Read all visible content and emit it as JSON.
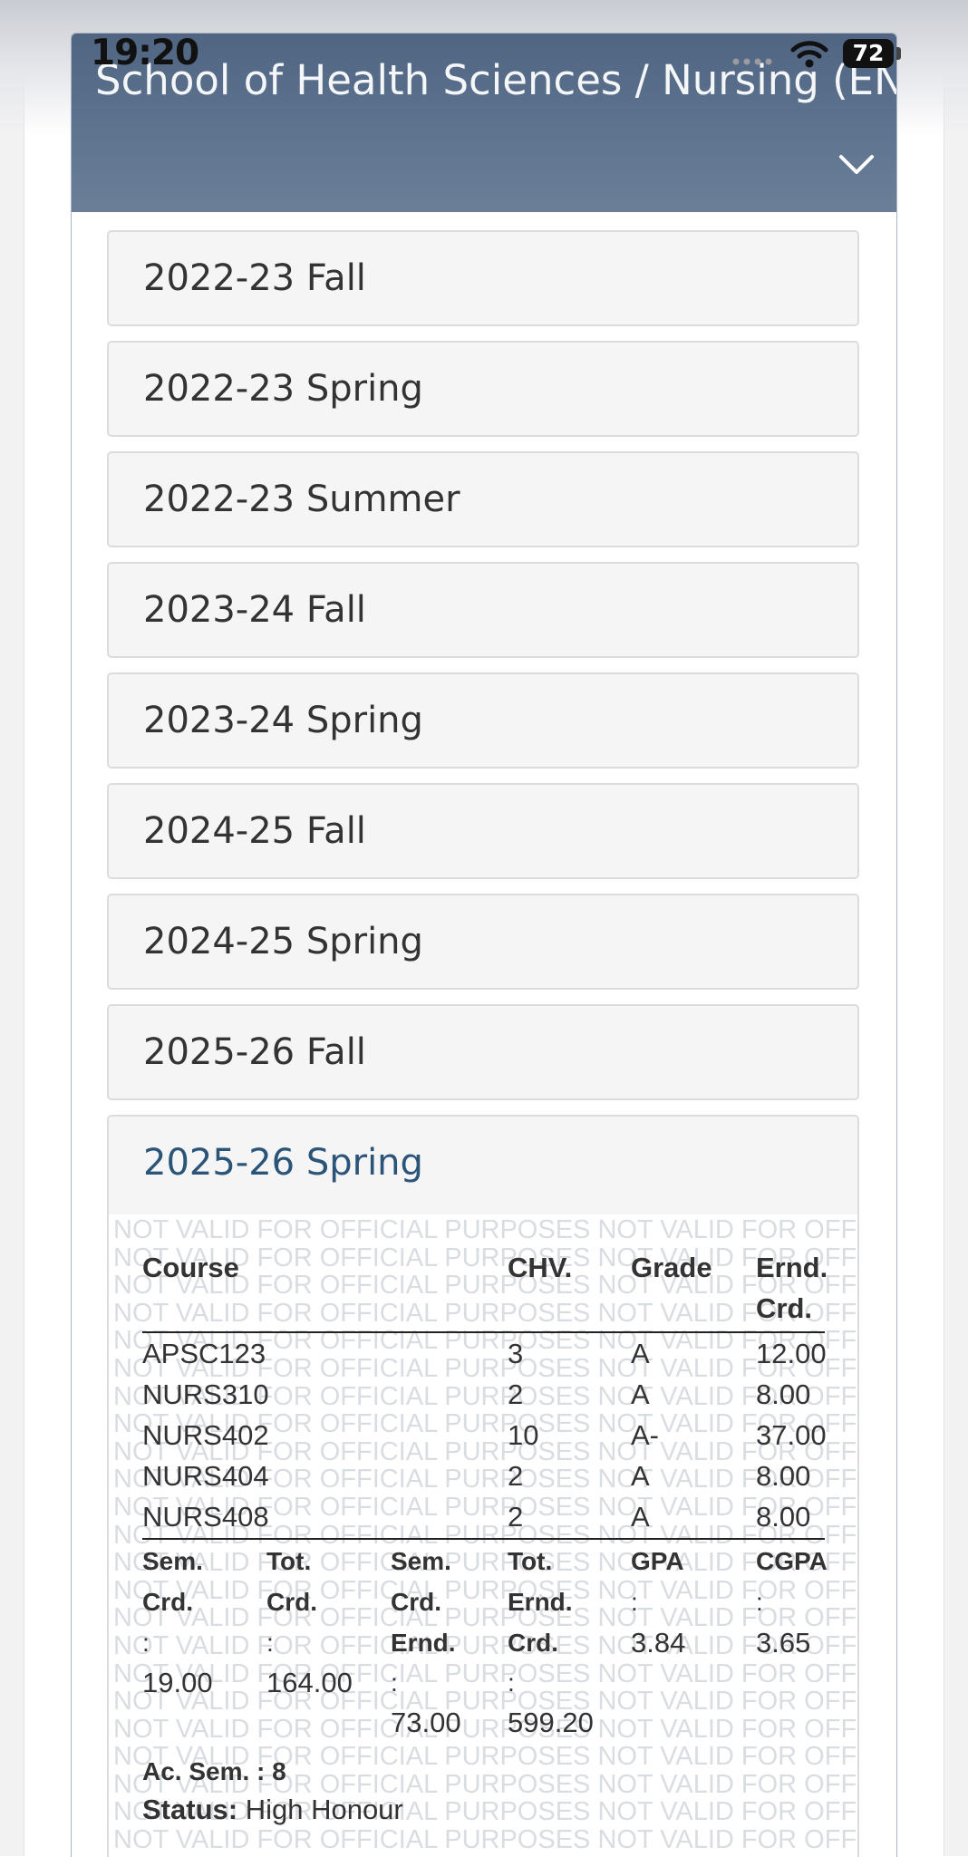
{
  "status_bar": {
    "time": "19:20",
    "battery": "72"
  },
  "header": {
    "title": "School of Health Sciences / Nursing (EN)"
  },
  "terms": [
    {
      "label": "2022-23 Fall"
    },
    {
      "label": "2022-23 Spring"
    },
    {
      "label": "2022-23 Summer"
    },
    {
      "label": "2023-24 Fall"
    },
    {
      "label": "2023-24 Spring"
    },
    {
      "label": "2024-25 Fall"
    },
    {
      "label": "2024-25 Spring"
    },
    {
      "label": "2025-26 Fall"
    },
    {
      "label": "2025-26 Spring"
    }
  ],
  "watermark": "NOT VALID FOR OFFICIAL PURPOSES NOT VALID FOR OFFICIAL PURPOSES",
  "table": {
    "headers": {
      "course": "Course",
      "chv": "CHV.",
      "grade": "Grade",
      "ernd": "Ernd.",
      "crd": "Crd."
    },
    "rows": [
      {
        "course": "APSC123",
        "chv": "3",
        "grade": "A",
        "earned": "12.00"
      },
      {
        "course": "NURS310",
        "chv": "2",
        "grade": "A",
        "earned": "8.00"
      },
      {
        "course": "NURS402",
        "chv": "10",
        "grade": "A-",
        "earned": "37.00"
      },
      {
        "course": "NURS404",
        "chv": "2",
        "grade": "A",
        "earned": "8.00"
      },
      {
        "course": "NURS408",
        "chv": "2",
        "grade": "A",
        "earned": "8.00"
      }
    ]
  },
  "summary": {
    "sem_crd_l1": "Sem.",
    "sem_crd_l2": "Crd.",
    "sem_crd_value": "19.00",
    "tot_crd_l1": "Tot.",
    "tot_crd_l2": "Crd.",
    "tot_crd_value": "164.00",
    "sem_ernd_l1": "Sem.",
    "sem_ernd_l2": "Crd.",
    "sem_ernd_l3": "Ernd.",
    "sem_ernd_value": "73.00",
    "tot_ernd_l1": "Tot.",
    "tot_ernd_l2": "Ernd.",
    "tot_ernd_l3": "Crd.",
    "tot_ernd_value": "599.20",
    "gpa_label": "GPA",
    "gpa_value": "3.84",
    "cgpa_label": "CGPA",
    "cgpa_value": "3.65",
    "colon": ":",
    "ac_sem_label": "Ac. Sem. : 8",
    "status_label": "Status:",
    "status_value": "High Honour"
  }
}
